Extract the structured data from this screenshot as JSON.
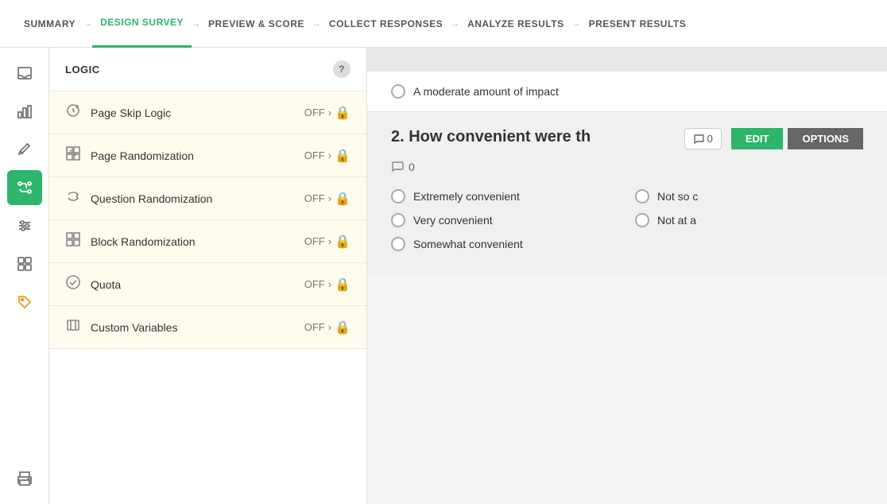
{
  "nav": {
    "items": [
      {
        "id": "summary",
        "label": "SUMMARY",
        "active": false
      },
      {
        "id": "design",
        "label": "DESIGN SURVEY",
        "active": true
      },
      {
        "id": "preview",
        "label": "PREVIEW & SCORE",
        "active": false
      },
      {
        "id": "collect",
        "label": "COLLECT RESPONSES",
        "active": false
      },
      {
        "id": "analyze",
        "label": "ANALYZE RESULTS",
        "active": false
      },
      {
        "id": "present",
        "label": "PRESENT RESULTS",
        "active": false
      }
    ]
  },
  "icons": [
    {
      "id": "inbox",
      "symbol": "⊟",
      "active": false
    },
    {
      "id": "chart",
      "symbol": "▦",
      "active": false
    },
    {
      "id": "pencil",
      "symbol": "✏",
      "active": false
    },
    {
      "id": "branch",
      "symbol": "⑃",
      "active": true
    },
    {
      "id": "adjust",
      "symbol": "⊞",
      "active": false
    },
    {
      "id": "grid",
      "symbol": "⊞",
      "active": false
    },
    {
      "id": "tag",
      "symbol": "⬧",
      "active": false
    },
    {
      "id": "print",
      "symbol": "⎙",
      "active": false
    }
  ],
  "logic": {
    "header": "LOGIC",
    "help_label": "?",
    "items": [
      {
        "id": "page-skip",
        "icon": "↺",
        "label": "Page Skip Logic",
        "status": "OFF"
      },
      {
        "id": "page-rand",
        "icon": "⊠",
        "label": "Page Randomization",
        "status": "OFF"
      },
      {
        "id": "question-rand",
        "icon": "⇄",
        "label": "Question Randomization",
        "status": "OFF"
      },
      {
        "id": "block-rand",
        "icon": "⊠",
        "label": "Block Randomization",
        "status": "OFF"
      },
      {
        "id": "quota",
        "icon": "✓",
        "label": "Quota",
        "status": "OFF"
      },
      {
        "id": "custom-vars",
        "icon": "[]",
        "label": "Custom Variables",
        "status": "OFF"
      }
    ]
  },
  "survey": {
    "moderate_option": "A moderate amount of impact",
    "question2": {
      "number": "2.",
      "title": "How convenient were th",
      "title_full": "2. How convenient were th",
      "comment_count": "0",
      "meta_comment_count": "0",
      "edit_label": "EDIT",
      "options_label": "OPTIONS",
      "options": [
        {
          "id": "opt1",
          "text": "Extremely convenient",
          "col": 1
        },
        {
          "id": "opt2",
          "text": "Not so c",
          "col": 2
        },
        {
          "id": "opt3",
          "text": "Very convenient",
          "col": 1
        },
        {
          "id": "opt4",
          "text": "Not at a",
          "col": 2
        },
        {
          "id": "opt5",
          "text": "Somewhat convenient",
          "col": 1
        }
      ]
    }
  }
}
